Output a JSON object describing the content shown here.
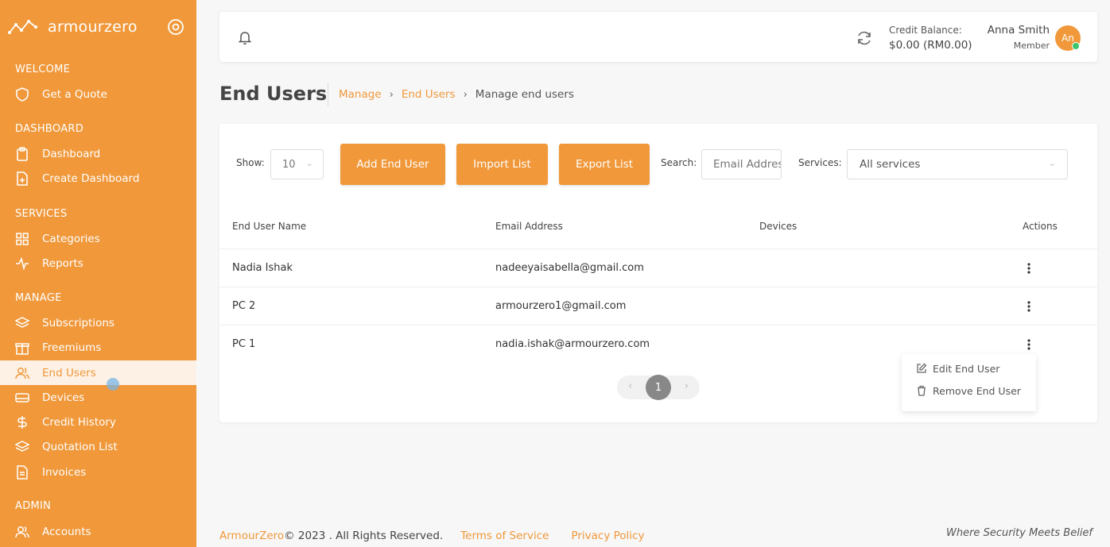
{
  "brand": {
    "name": "armourzero"
  },
  "sidebar": {
    "sections": [
      {
        "title": "WELCOME",
        "items": [
          {
            "label": "Get a Quote",
            "icon": "shield-icon"
          }
        ]
      },
      {
        "title": "DASHBOARD",
        "items": [
          {
            "label": "Dashboard",
            "icon": "clipboard-icon"
          },
          {
            "label": "Create Dashboard",
            "icon": "file-plus-icon"
          }
        ]
      },
      {
        "title": "SERVICES",
        "items": [
          {
            "label": "Categories",
            "icon": "grid-icon"
          },
          {
            "label": "Reports",
            "icon": "activity-icon"
          }
        ]
      },
      {
        "title": "MANAGE",
        "items": [
          {
            "label": "Subscriptions",
            "icon": "layers-icon"
          },
          {
            "label": "Freemiums",
            "icon": "gift-icon"
          },
          {
            "label": "End Users",
            "icon": "users-icon",
            "active": true
          },
          {
            "label": "Devices",
            "icon": "hard-drive-icon"
          },
          {
            "label": "Credit History",
            "icon": "dollar-icon"
          },
          {
            "label": "Quotation List",
            "icon": "layers-icon"
          },
          {
            "label": "Invoices",
            "icon": "file-text-icon"
          }
        ]
      },
      {
        "title": "ADMIN",
        "items": [
          {
            "label": "Accounts",
            "icon": "users-icon"
          }
        ]
      }
    ]
  },
  "topbar": {
    "credit_label": "Credit Balance:",
    "credit_amount": "$0.00 (RM0.00)",
    "user_name": "Anna Smith",
    "user_role": "Member",
    "avatar_initials": "An"
  },
  "page": {
    "title": "End Users",
    "breadcrumb": [
      "Manage",
      "End Users",
      "Manage end users"
    ]
  },
  "toolbar": {
    "show_label": "Show:",
    "show_value": "10",
    "add_button": "Add End User",
    "import_button": "Import List",
    "export_button": "Export List",
    "search_label": "Search:",
    "search_placeholder": "Email Address",
    "services_label": "Services:",
    "services_value": "All services"
  },
  "table": {
    "columns": [
      "End User Name",
      "Email Address",
      "Devices",
      "Actions"
    ],
    "rows": [
      {
        "name": "Nadia Ishak",
        "email": "nadeeyaisabella@gmail.com",
        "devices": ""
      },
      {
        "name": "PC 2",
        "email": "armourzero1@gmail.com",
        "devices": ""
      },
      {
        "name": "PC 1",
        "email": "nadia.ishak@armourzero.com",
        "devices": ""
      }
    ]
  },
  "row_menu": {
    "edit": "Edit End User",
    "remove": "Remove End User"
  },
  "pagination": {
    "prev": "‹",
    "current": "1",
    "next": "›"
  },
  "footer": {
    "brand": "ArmourZero",
    "copyright": " © 2023 . All Rights Reserved.",
    "terms": "Terms of Service",
    "privacy": "Privacy Policy",
    "tagline": "Where Security Meets Belief"
  },
  "colors": {
    "accent": "#f0983a",
    "active_bg": "#fdf1e5",
    "online": "#3bc46a"
  }
}
